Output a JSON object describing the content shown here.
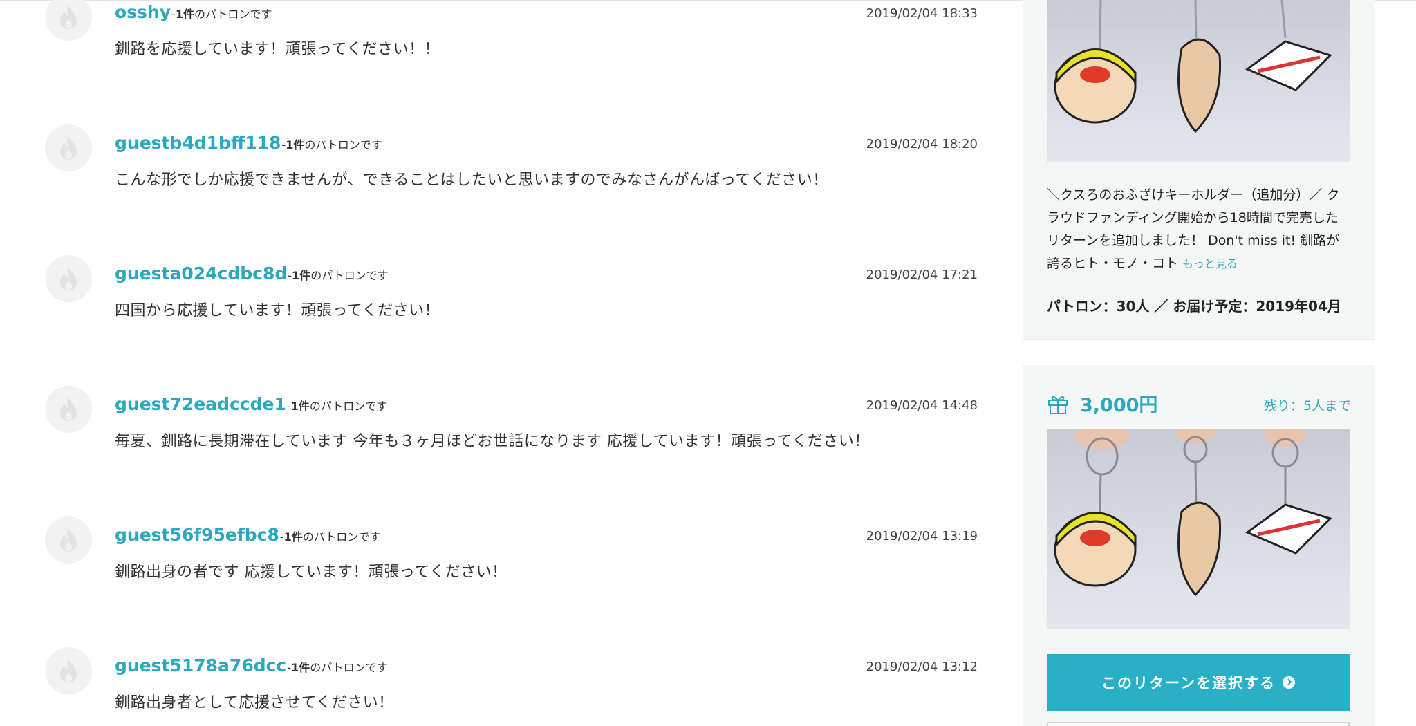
{
  "comments": [
    {
      "user": "osshy",
      "count_prefix": "-",
      "count_num": "1件",
      "count_suffix": "のパトロンです",
      "date": "2019/02/04 18:33",
      "text": "釧路を応援しています！頑張ってください！！"
    },
    {
      "user": "guestb4d1bff118",
      "count_prefix": "-",
      "count_num": "1件",
      "count_suffix": "のパトロンです",
      "date": "2019/02/04 18:20",
      "text": "こんな形でしか応援できませんが、できることはしたいと思いますのでみなさんがんばってください！"
    },
    {
      "user": "guesta024cdbc8d",
      "count_prefix": "-",
      "count_num": "1件",
      "count_suffix": "のパトロンです",
      "date": "2019/02/04 17:21",
      "text": "四国から応援しています！頑張ってください！"
    },
    {
      "user": "guest72eadccde1",
      "count_prefix": "-",
      "count_num": "1件",
      "count_suffix": "のパトロンです",
      "date": "2019/02/04 14:48",
      "text": "毎夏、釧路に長期滞在しています 今年も３ヶ月ほどお世話になります 応援しています！頑張ってください！"
    },
    {
      "user": "guest56f95efbc8",
      "count_prefix": "-",
      "count_num": "1件",
      "count_suffix": "のパトロンです",
      "date": "2019/02/04 13:19",
      "text": "釧路出身の者です 応援しています！頑張ってください！"
    },
    {
      "user": "guest5178a76dcc",
      "count_prefix": "-",
      "count_num": "1件",
      "count_suffix": "のパトロンです",
      "date": "2019/02/04 13:12",
      "text": "釧路出身者として応援させてください！"
    }
  ],
  "reward_prev": {
    "description": "＼クスろのおふざけキーホルダー（追加分）／ クラウドファンディング開始から18時間で完売したリターンを追加しました！ Don't miss it! 釧路が誇るヒト・モノ・コト",
    "more_label": "もっと見る",
    "stats": "パトロン：30人 ／ お届け予定：2019年04月"
  },
  "reward": {
    "price": "3,000円",
    "remaining": "残り：5人まで",
    "select_label": "このリターンを選択する"
  },
  "colors": {
    "accent": "#2aa8bd",
    "button": "#2ab0c6",
    "sidebar_bg": "#f5f7f6"
  },
  "icons": {
    "avatar": "flame-icon",
    "gift": "gift-icon",
    "arrow": "arrow-circle-right-icon"
  }
}
